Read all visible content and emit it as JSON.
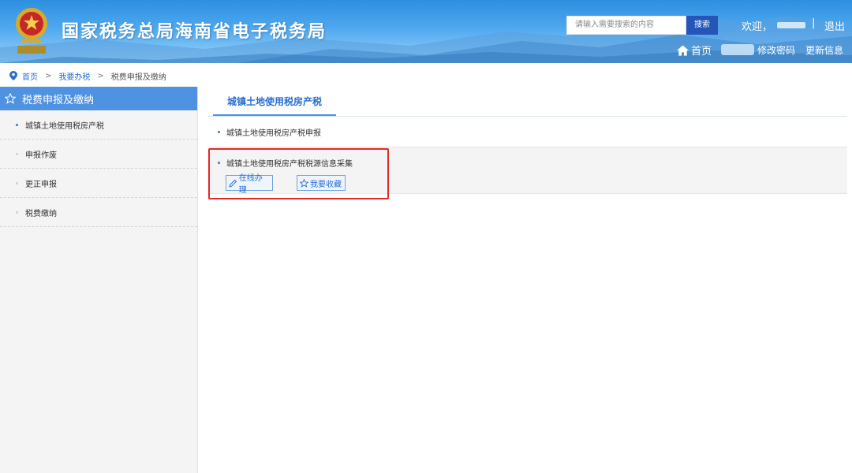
{
  "header": {
    "site_title": "国家税务总局海南省电子税务局",
    "search_placeholder": "请输入需要搜索的内容",
    "search_button": "搜索",
    "welcome": "欢迎，",
    "separator": "|",
    "logout": "退出",
    "home": "首页",
    "change_password": "修改密码",
    "update_info": "更新信息"
  },
  "breadcrumb": {
    "home": "首页",
    "arrow1": ">",
    "level2": "我要办税",
    "arrow2": ">",
    "current": "税费申报及缴纳"
  },
  "sidebar": {
    "header": "税费申报及缴纳",
    "items": [
      {
        "label": "城镇土地使用税房产税",
        "active": true
      },
      {
        "label": "申报作废",
        "active": false
      },
      {
        "label": "更正申报",
        "active": false
      },
      {
        "label": "税费缴纳",
        "active": false
      }
    ]
  },
  "main": {
    "tab_label": "城镇土地使用税房产税",
    "items": [
      {
        "title": "城镇土地使用税房产税申报"
      },
      {
        "title": "城镇土地使用税房产税税源信息采集",
        "buttons": [
          "在线办理",
          "我要收藏"
        ]
      }
    ]
  },
  "colors": {
    "accent": "#4f92e2",
    "link": "#2a6ed1",
    "highlight": "#e02a2a"
  },
  "icons": [
    "emblem-icon",
    "home-icon",
    "location-pin-icon",
    "star-outline-icon",
    "edit-icon"
  ]
}
